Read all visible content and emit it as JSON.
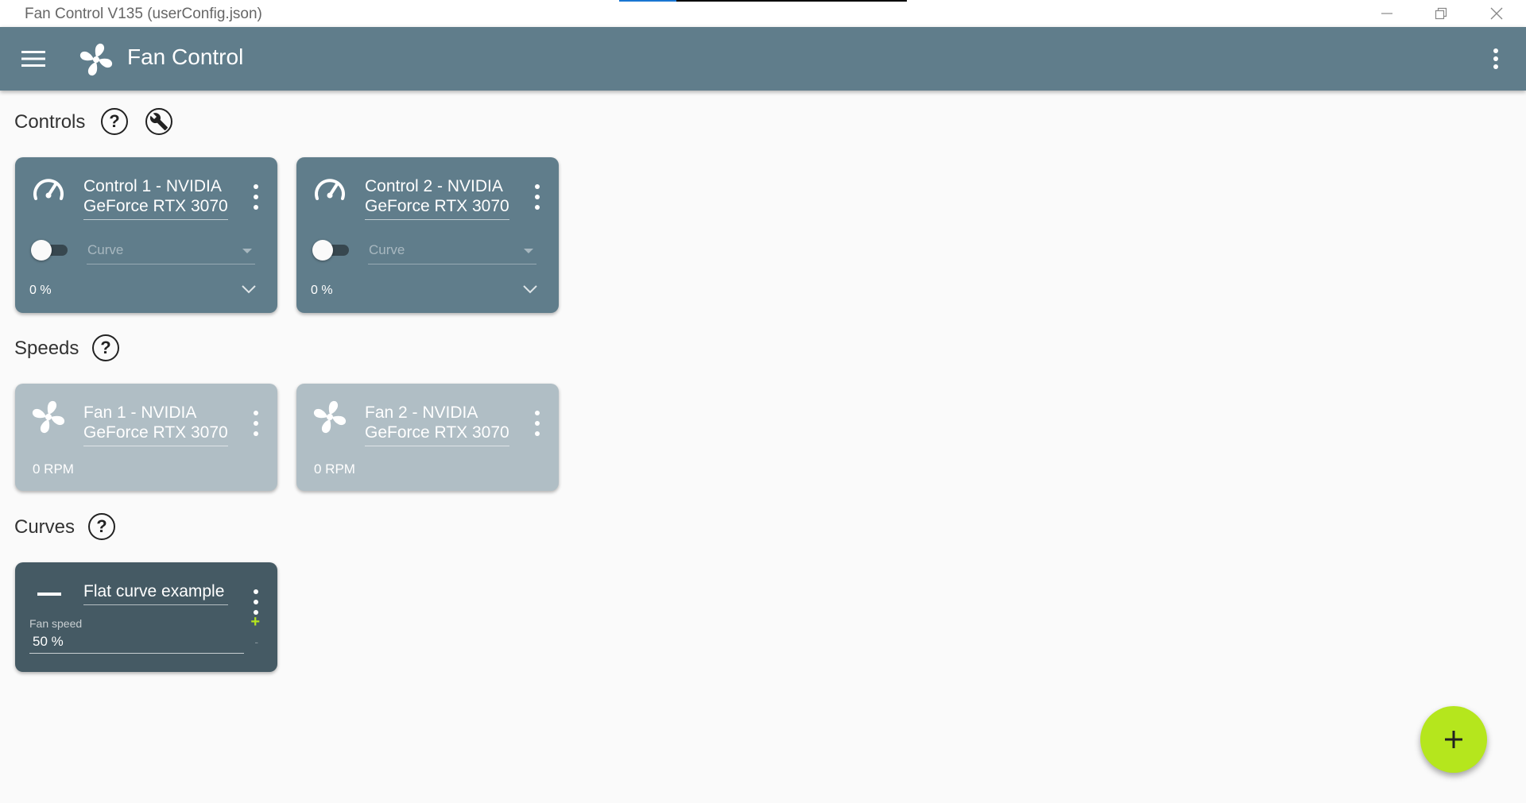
{
  "window": {
    "title": "Fan Control V135 (userConfig.json)"
  },
  "appbar": {
    "title": "Fan Control"
  },
  "sections": {
    "controls": "Controls",
    "speeds": "Speeds",
    "curves": "Curves"
  },
  "controls": [
    {
      "title": "Control 1 - NVIDIA GeForce RTX 3070",
      "mode": "Curve",
      "percent": "0 %",
      "enabled": false
    },
    {
      "title": "Control 2 - NVIDIA GeForce RTX 3070",
      "mode": "Curve",
      "percent": "0 %",
      "enabled": false
    }
  ],
  "speeds": [
    {
      "title": "Fan 1 - NVIDIA GeForce RTX 3070",
      "rpm": "0 RPM"
    },
    {
      "title": "Fan 2 - NVIDIA GeForce RTX 3070",
      "rpm": "0 RPM"
    }
  ],
  "curves": [
    {
      "title": "Flat curve example",
      "field_label": "Fan speed",
      "value": "50 %",
      "plus": "+",
      "minus": "-"
    }
  ],
  "help_glyph": "?",
  "colors": {
    "appbar": "#607d8b",
    "control_card": "#607d8b",
    "speed_card": "#b0bec5",
    "curve_card": "#455a64",
    "accent": "#b5e61d",
    "background": "#fafafa"
  },
  "icons": {
    "menu": "hamburger-icon",
    "logo": "fan-icon",
    "more": "more-vert-icon",
    "help": "help-icon",
    "tools": "wrench-icon",
    "control": "speedometer-icon",
    "speed": "fan-icon",
    "curve": "flat-line-icon",
    "fab": "plus-icon"
  }
}
